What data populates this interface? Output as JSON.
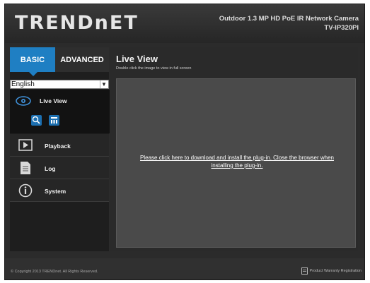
{
  "header": {
    "logo": "TRENDnET",
    "product_line1": "Outdoor 1.3 MP HD PoE IR Network Camera",
    "product_line2": "TV-IP320PI"
  },
  "sidebar": {
    "tabs": [
      {
        "label": "BASIC",
        "active": true
      },
      {
        "label": "ADVANCED",
        "active": false
      }
    ],
    "language": {
      "selected": "English"
    },
    "items": [
      {
        "label": "Live View",
        "icon": "eye-icon",
        "active": true
      },
      {
        "label": "Playback",
        "icon": "play-icon"
      },
      {
        "label": "Log",
        "icon": "log-document-icon"
      },
      {
        "label": "System",
        "icon": "info-icon"
      }
    ],
    "live_view_tools": [
      "zoom-icon",
      "layout-icon"
    ]
  },
  "main": {
    "title": "Live View",
    "subtitle": "Double click the image to view in full screen",
    "plugin_message": "Please click here to download and install the plug-in. Close the browser when installing the plug-in."
  },
  "footer": {
    "copyright": "© Copyright 2013 TRENDnet. All Rights Reserved.",
    "warranty_link": "Product Warranty Registration"
  },
  "colors": {
    "accent": "#1f7fc3",
    "background": "#2b2b2b",
    "viewer": "#4a4a4a"
  }
}
